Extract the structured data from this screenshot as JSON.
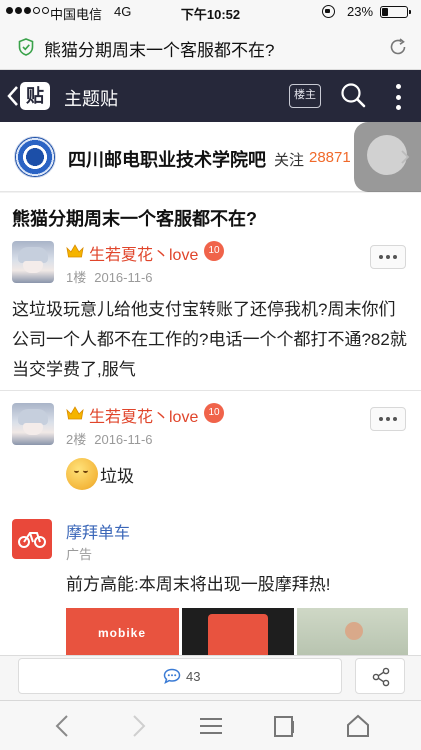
{
  "status_bar": {
    "carrier": "中国电信",
    "network": "4G",
    "time": "下午10:52",
    "battery": "23%"
  },
  "address_bar": {
    "page_title": "熊猫分期周末一个客服都不在?"
  },
  "header": {
    "logo_text": "贴",
    "title": "主题贴",
    "owner_only_label": "楼主"
  },
  "forum": {
    "name": "四川邮电职业技术学院吧",
    "follow_label": "关注",
    "follow_count": "28871"
  },
  "post": {
    "title": "熊猫分期周末一个客服都不在?",
    "floors": [
      {
        "username": "生若夏花丶love",
        "level": "10",
        "floor": "1楼",
        "date": "2016-11-6",
        "content": "这垃圾玩意儿给他支付宝转账了还停我机?周末你们公司一个人都不在工作的?电话一个个都打不通?82就当交学费了,服气"
      },
      {
        "username": "生若夏花丶love",
        "level": "10",
        "floor": "2楼",
        "date": "2016-11-6",
        "content": "垃圾"
      }
    ]
  },
  "ad": {
    "name": "摩拜单车",
    "label": "广告",
    "headline": "前方高能:本周末将出现一股摩拜热!",
    "image_brand": "mobike"
  },
  "reply_bar": {
    "reply_count": "43"
  },
  "colors": {
    "header_bg": "#26283a",
    "username": "#e0452b",
    "level_badge": "#f0634a",
    "follow_count": "#f06a2b",
    "ad_name": "#3a66b8",
    "mobike_red": "#e9483a"
  }
}
